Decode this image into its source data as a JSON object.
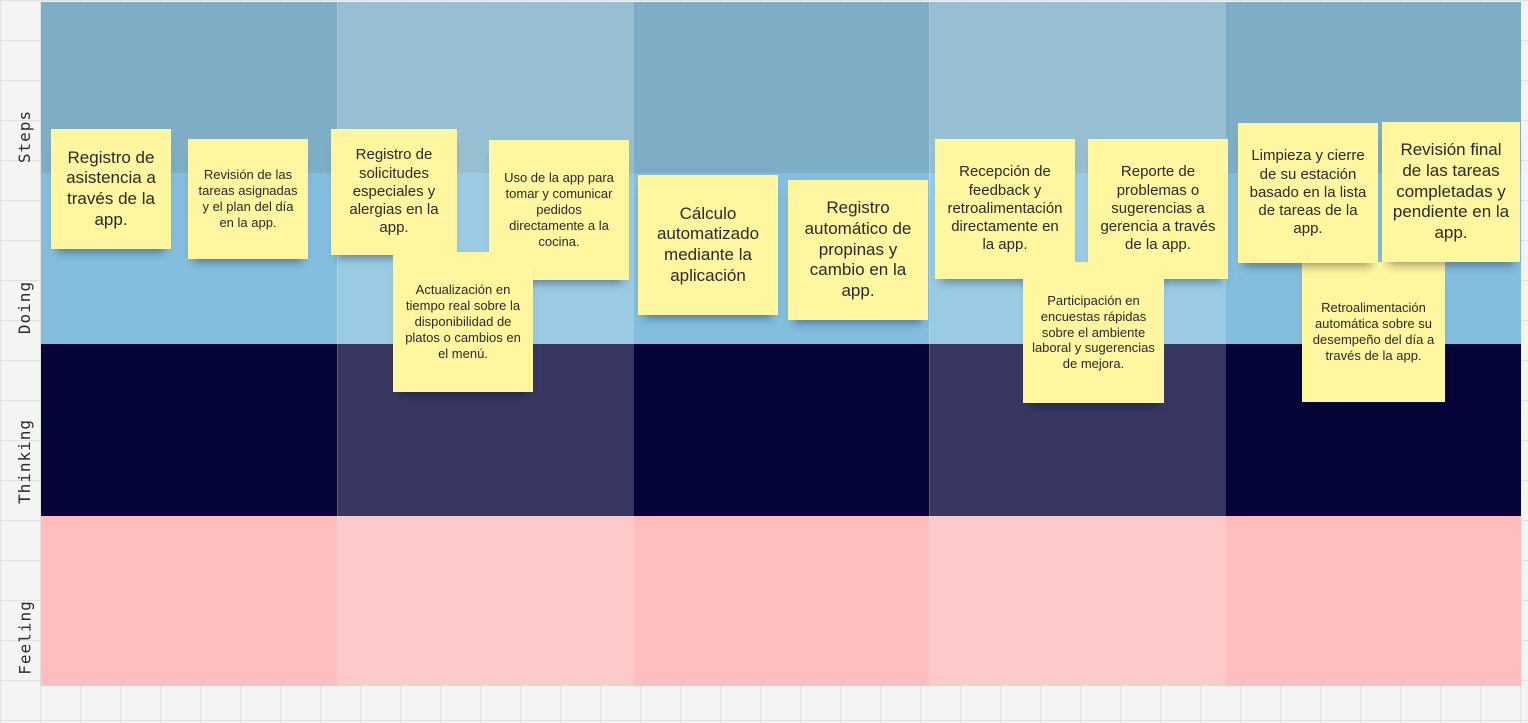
{
  "lanes": {
    "steps": "Steps",
    "doing": "Doing",
    "thinking": "Thinking",
    "feeling": "Feeling"
  },
  "colors": {
    "steps_lane": "#7eaec6",
    "doing_lane": "#83bede",
    "thinking_lane": "#05053a",
    "feeling_lane": "#ffbdbd",
    "sticky_note": "#fff6a0"
  },
  "notes": {
    "n1": "Registro de asistencia a través de la app.",
    "n2": "Revisión de las tareas asignadas y el plan del día en la app.",
    "n3": "Registro de solicitudes especiales y alergias en la app.",
    "n4": "Actualización en tiempo real sobre la disponibilidad de platos o cambios en el menú.",
    "n5": "Uso de la app para tomar y comunicar pedidos directamente a la cocina.",
    "n6": "Cálculo automatizado mediante la aplicación",
    "n7": "Registro automático de propinas y cambio en la app.",
    "n8": "Recepción de feedback y retroalimentación directamente en la app.",
    "n9": "Participación en encuestas rápidas sobre el ambiente laboral y sugerencias de mejora.",
    "n10": "Reporte de problemas o sugerencias a gerencia a través de la app.",
    "n11": "Limpieza y cierre de su estación basado en la lista de tareas de la app.",
    "n12": "Revisión final de las tareas completadas y pendiente en la app.",
    "n13": "Retroalimentación automática sobre su desempeño del día a través de la app."
  }
}
